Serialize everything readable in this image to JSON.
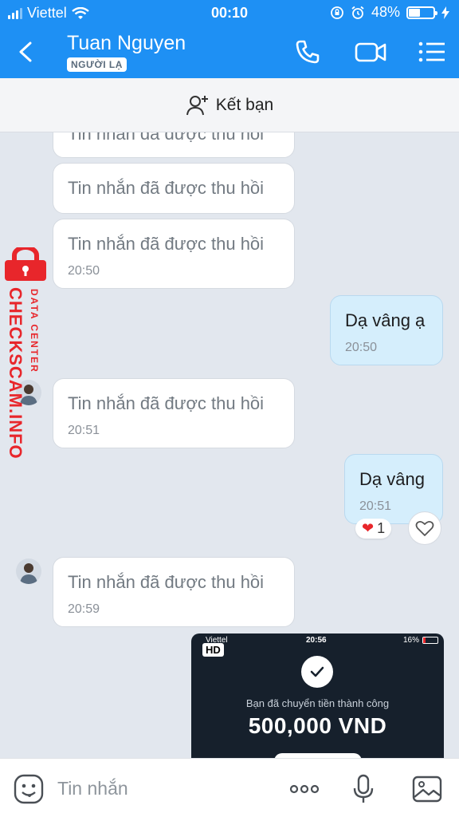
{
  "status_bar": {
    "carrier": "Viettel",
    "time": "00:10",
    "battery": "48%",
    "battery_level": 0.48
  },
  "header": {
    "contact_name": "Tuan Nguyen",
    "stranger_label": "NGƯỜI LẠ",
    "icons": [
      "back-icon",
      "phone-icon",
      "video-call-icon",
      "menu-icon"
    ]
  },
  "add_friend": {
    "label": "Kết bạn"
  },
  "messages": [
    {
      "direction": "in",
      "text": "Tin nhắn đã được thu hồi"
    },
    {
      "direction": "in",
      "text": "Tin nhắn đã được thu hồi"
    },
    {
      "direction": "in",
      "text": "Tin nhắn đã được thu hồi",
      "time": "20:50"
    },
    {
      "direction": "out",
      "text": "Dạ vâng ạ",
      "time": "20:50"
    },
    {
      "direction": "in",
      "text": "Tin nhắn đã được thu hồi",
      "time": "20:51"
    },
    {
      "direction": "out",
      "text": "Dạ vâng",
      "time": "20:51"
    },
    {
      "direction": "in",
      "text": "Tin nhắn đã được thu hồi",
      "time": "20:59"
    }
  ],
  "reaction": {
    "emoji": "❤",
    "count": "1"
  },
  "watermark": {
    "brand": "CHECKSCAM.INFO",
    "subtitle": "DATA CENTER"
  },
  "image_message": {
    "badge": "HD",
    "status_carrier": "Viettel",
    "status_time": "20:56",
    "status_battery": "16%",
    "caption": "Bạn đã chuyển tiền thành công",
    "amount": "500,000 VND"
  },
  "composer": {
    "placeholder": "Tin nhắn"
  },
  "colors": {
    "header": "#1e90f4",
    "chat_bg": "#e2e7ee",
    "incoming": "#ffffff",
    "outgoing": "#d5eefc",
    "watermark": "#e8262b"
  }
}
